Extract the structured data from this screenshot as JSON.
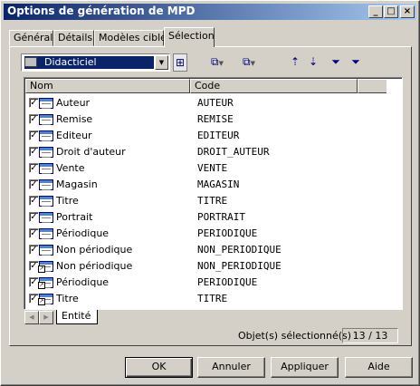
{
  "window": {
    "title": "Options de génération de MPD"
  },
  "titlebar_buttons": [
    {
      "icon": "minimize-icon",
      "glyph": "_"
    },
    {
      "icon": "maximize-icon",
      "glyph": "□"
    },
    {
      "icon": "close-icon",
      "glyph": "×"
    }
  ],
  "tabs": [
    {
      "label": "Général",
      "active": false
    },
    {
      "label": "Détails",
      "active": false
    },
    {
      "label": "Modèles cible",
      "active": false
    },
    {
      "label": "Sélection",
      "active": true
    }
  ],
  "toolbar": {
    "model_select": "Didacticiel",
    "icons": [
      "include-submodels-icon",
      "select-all-icon",
      "deselect-all-icon",
      "move-up-icon",
      "move-down-icon",
      "filter-icon",
      "clear-filter-icon"
    ]
  },
  "list": {
    "columns": [
      "Nom",
      "Code"
    ],
    "rows": [
      {
        "name": "Auteur",
        "code": "AUTEUR",
        "checked": true,
        "shortcut": false
      },
      {
        "name": "Remise",
        "code": "REMISE",
        "checked": true,
        "shortcut": false
      },
      {
        "name": "Editeur",
        "code": "EDITEUR",
        "checked": true,
        "shortcut": false
      },
      {
        "name": "Droit d'auteur",
        "code": "DROIT_AUTEUR",
        "checked": true,
        "shortcut": false
      },
      {
        "name": "Vente",
        "code": "VENTE",
        "checked": true,
        "shortcut": false
      },
      {
        "name": "Magasin",
        "code": "MAGASIN",
        "checked": true,
        "shortcut": false
      },
      {
        "name": "Titre",
        "code": "TITRE",
        "checked": true,
        "shortcut": false
      },
      {
        "name": "Portrait",
        "code": "PORTRAIT",
        "checked": true,
        "shortcut": false
      },
      {
        "name": "Périodique",
        "code": "PERIODIQUE",
        "checked": true,
        "shortcut": false
      },
      {
        "name": "Non périodique",
        "code": "NON_PERIODIQUE",
        "checked": true,
        "shortcut": false
      },
      {
        "name": "Non périodique",
        "code": "NON_PERIODIQUE",
        "checked": true,
        "shortcut": true
      },
      {
        "name": "Périodique",
        "code": "PERIODIQUE",
        "checked": true,
        "shortcut": true
      },
      {
        "name": "Titre",
        "code": "TITRE",
        "checked": true,
        "shortcut": true
      }
    ]
  },
  "sheet_tab": "Entité",
  "status": {
    "label": "Objet(s) sélectionné(s) :",
    "count": "13 / 13"
  },
  "buttons": {
    "ok": "OK",
    "cancel": "Annuler",
    "apply": "Appliquer",
    "help": "Aide"
  }
}
